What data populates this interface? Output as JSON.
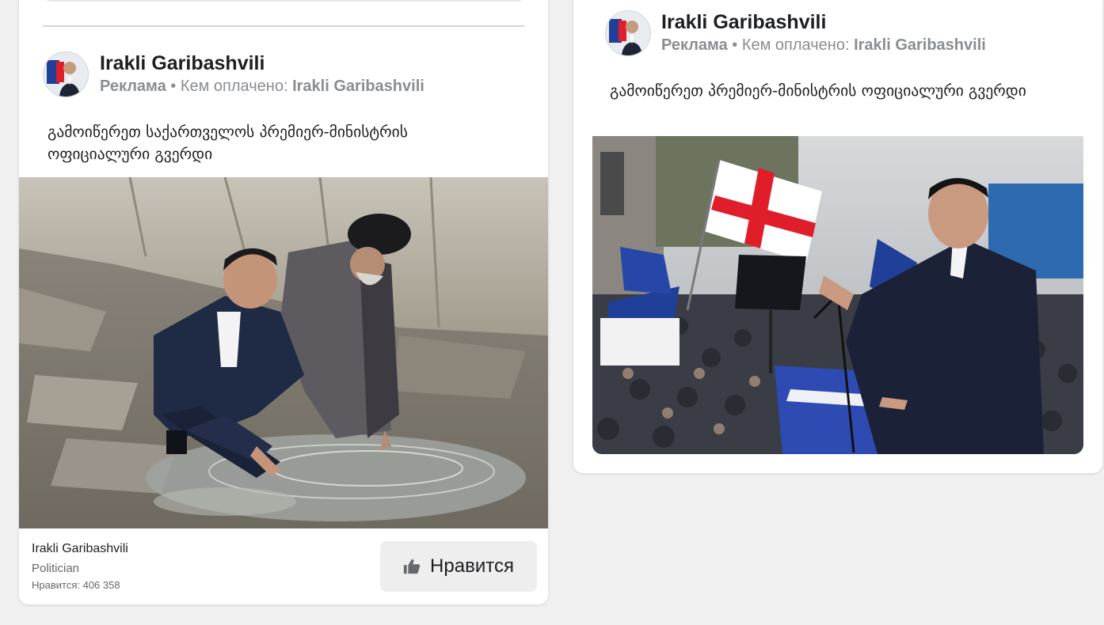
{
  "ads": [
    {
      "author": "Irakli Garibashvili",
      "sponsored_label": "Реклама",
      "separator": "•",
      "paid_by_label": "Кем оплачено:",
      "paid_by_name": "Irakli Garibashvili",
      "text": "გამოიწერეთ საქართველოს პრემიერ-მინისტრის ოფიციალური გვერდი",
      "image_alt": "Irakli Garibashvili and an Orthodox priest kneeling at water among stones",
      "footer": {
        "page_name": "Irakli Garibashvili",
        "category": "Politician",
        "likes": "Нравится: 406 358"
      },
      "like_button_label": "Нравится"
    },
    {
      "author": "Irakli Garibashvili",
      "sponsored_label": "Реклама",
      "separator": "•",
      "paid_by_label": "Кем оплачено:",
      "paid_by_name": "Irakli Garibashvili",
      "text": "გამოიწერეთ პრემიერ-მინისტრის ოფიციალური გვერდი",
      "image_alt": "Irakli Garibashvili speaking at a podium before a crowd with Georgian flags"
    }
  ],
  "colors": {
    "text_primary": "#1c1e21",
    "text_secondary": "#8a8d91",
    "georgian_flag_red": "#e01e2a",
    "eu_blue": "#1f3f99",
    "button_bg": "#eeeeee"
  },
  "icons": {
    "like": "thumbs-up-icon"
  }
}
